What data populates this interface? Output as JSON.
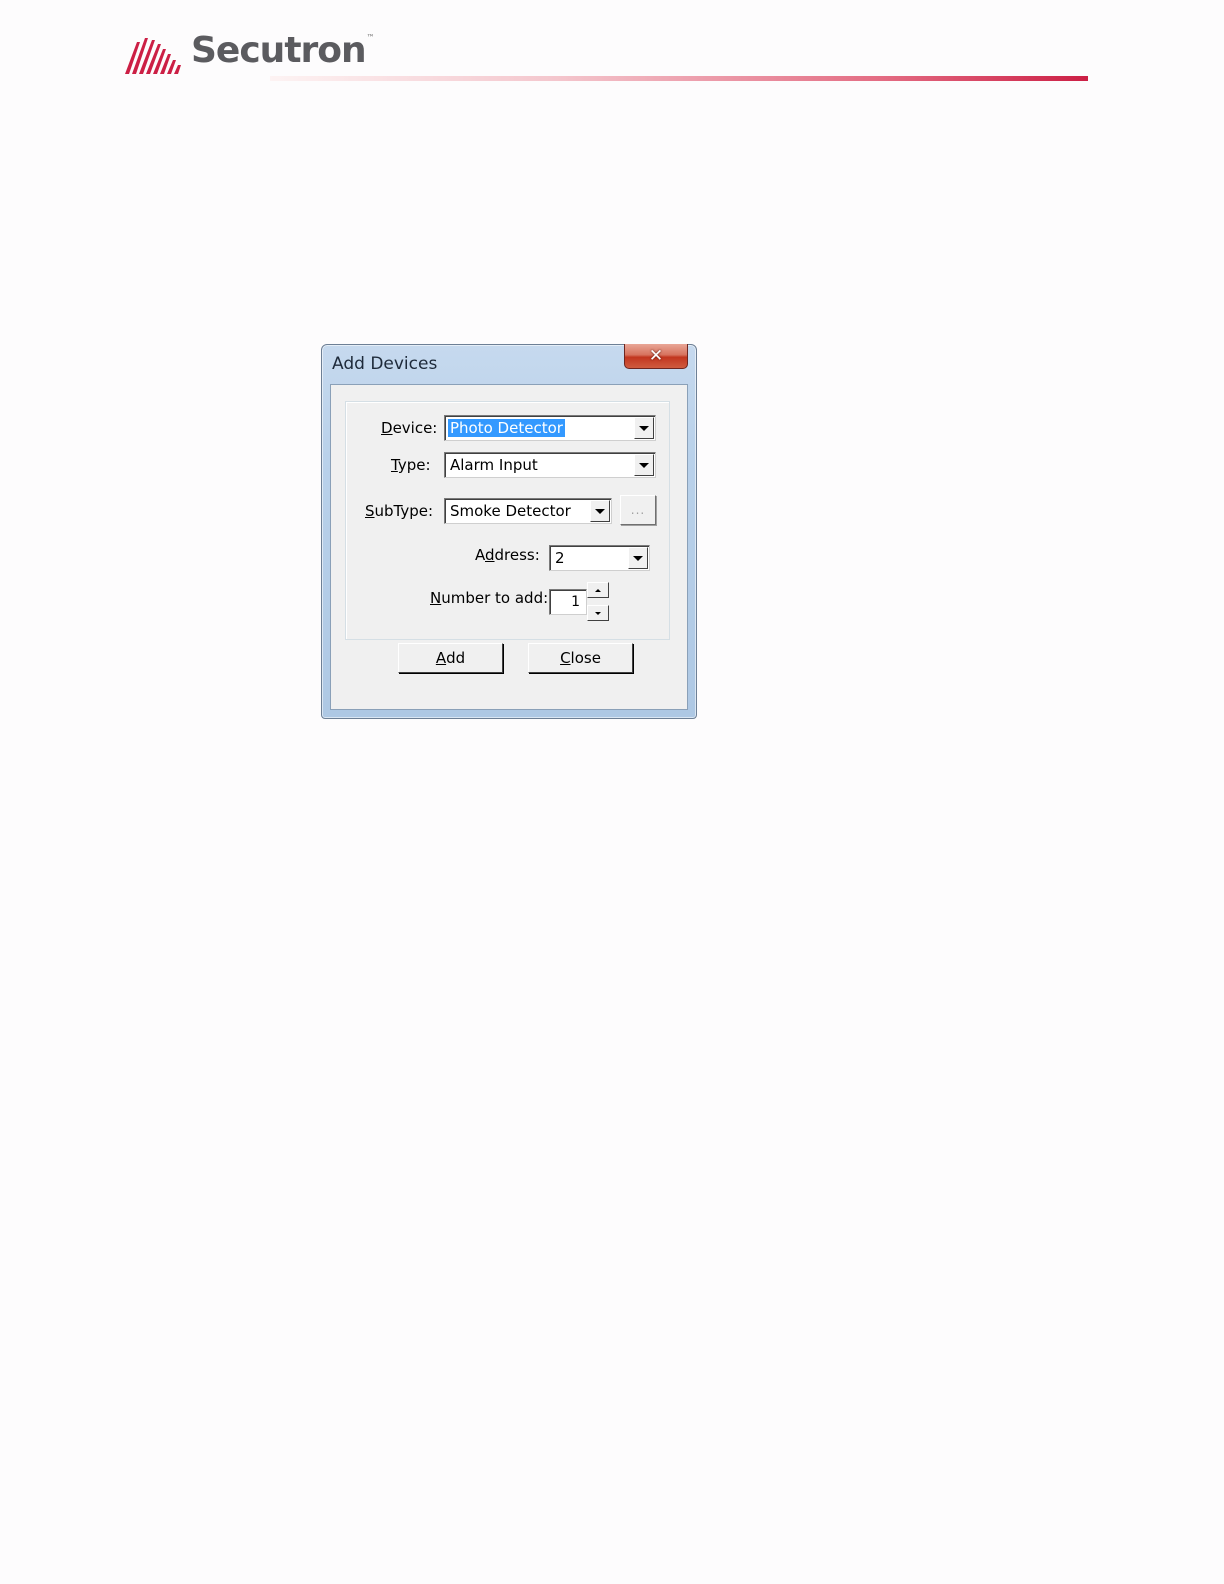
{
  "header": {
    "brand_name": "Secutron",
    "trademark": "™",
    "accent_color": "#cc1f45"
  },
  "dialog": {
    "title": "Add Devices",
    "close_symbol": "✕",
    "fields": {
      "device": {
        "label_mnemonic": "D",
        "label_rest": "evice:",
        "value": "Photo Detector"
      },
      "type": {
        "label_mnemonic": "T",
        "label_rest": "ype:",
        "value": "Alarm Input"
      },
      "subtype": {
        "label_mnemonic": "S",
        "label_rest": "ubType:",
        "value": "Smoke Detector",
        "browse_label": "..."
      },
      "address": {
        "label_before": "A",
        "label_mnemonic": "d",
        "label_rest": "dress:",
        "value": "2"
      },
      "number_to_add": {
        "label_mnemonic": "N",
        "label_rest": "umber to add:",
        "value": "1"
      }
    },
    "buttons": {
      "add": {
        "mnemonic": "A",
        "rest": "dd"
      },
      "close": {
        "mnemonic": "C",
        "rest": "lose"
      }
    }
  }
}
